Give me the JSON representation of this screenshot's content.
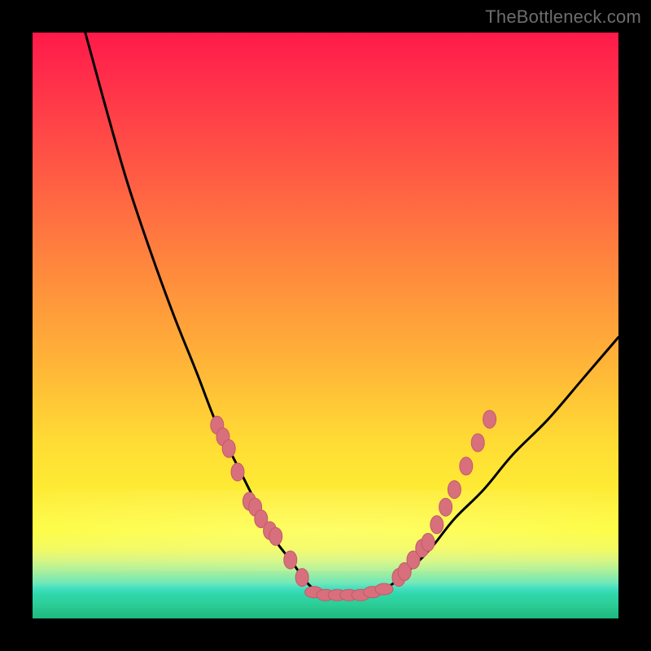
{
  "watermark": "TheBottleneck.com",
  "colors": {
    "curve": "#000000",
    "markerFill": "#d86f7d",
    "markerStroke": "#c45a69"
  },
  "chart_data": {
    "type": "line",
    "title": "",
    "xlabel": "",
    "ylabel": "",
    "xlim": [
      0,
      100
    ],
    "ylim": [
      0,
      100
    ],
    "grid": false,
    "legend": false,
    "series": [
      {
        "name": "curve",
        "x": [
          9,
          12,
          16,
          20,
          24,
          28,
          31.5,
          35,
          38,
          41,
          44,
          48,
          52,
          56,
          60,
          64,
          68,
          72,
          77,
          82,
          88,
          94,
          100
        ],
        "y": [
          100,
          89,
          75,
          63,
          52,
          42,
          33,
          26,
          20,
          14,
          10,
          5,
          4,
          4,
          5,
          8,
          12,
          17,
          22,
          28,
          34,
          41,
          48
        ]
      }
    ],
    "markers": {
      "left": {
        "x": [
          31.5,
          32.5,
          33.5,
          35,
          37,
          38,
          39,
          40.5,
          41.5,
          44,
          46
        ],
        "y": [
          33,
          31,
          29,
          25,
          20,
          19,
          17,
          15,
          14,
          10,
          7
        ]
      },
      "bottom": {
        "x": [
          48,
          50,
          52,
          54,
          56,
          58,
          60
        ],
        "y": [
          4.5,
          4,
          4,
          4,
          4,
          4.5,
          5
        ]
      },
      "right": {
        "x": [
          62.5,
          63.5,
          65,
          66.5,
          67.5,
          69,
          70.5,
          72,
          74,
          76,
          78
        ],
        "y": [
          7,
          8,
          10,
          12,
          13,
          16,
          19,
          22,
          26,
          30,
          34
        ]
      }
    }
  }
}
